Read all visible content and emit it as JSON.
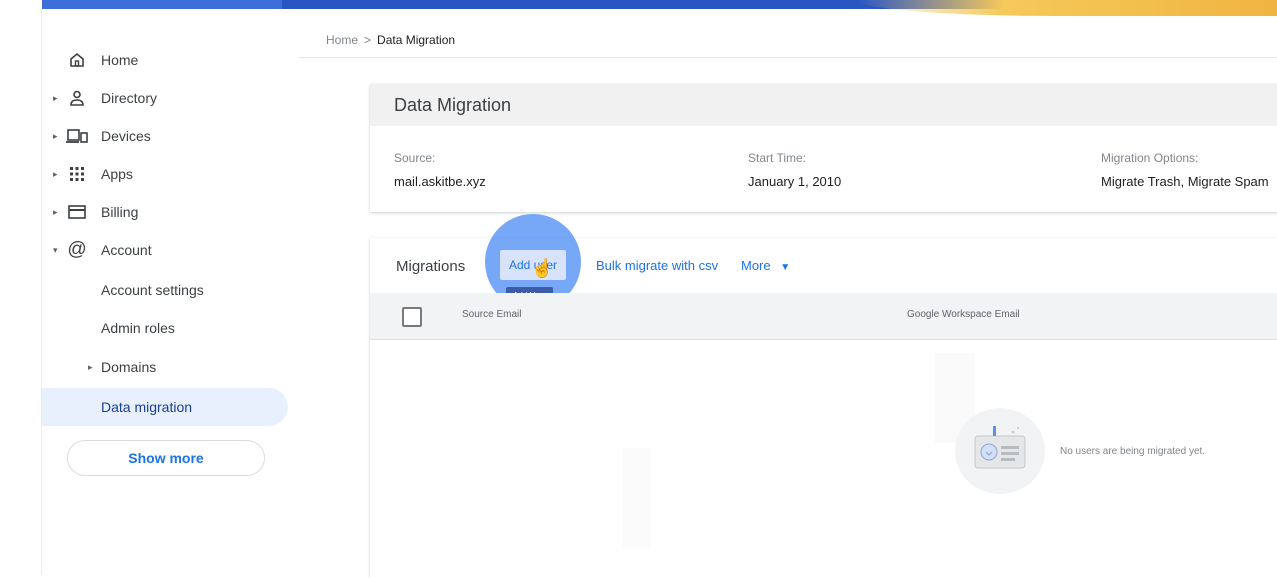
{
  "breadcrumb": {
    "home": "Home",
    "separator": ">",
    "current": "Data Migration"
  },
  "sidebar": {
    "items": [
      {
        "label": "Home",
        "icon": "home-icon",
        "expandable": false
      },
      {
        "label": "Directory",
        "icon": "person-icon",
        "expandable": true
      },
      {
        "label": "Devices",
        "icon": "devices-icon",
        "expandable": true
      },
      {
        "label": "Apps",
        "icon": "apps-grid-icon",
        "expandable": true
      },
      {
        "label": "Billing",
        "icon": "credit-card-icon",
        "expandable": true
      },
      {
        "label": "Account",
        "icon": "at-sign-icon",
        "expandable": true,
        "expanded": true
      }
    ],
    "account_children": [
      {
        "label": "Account settings"
      },
      {
        "label": "Admin roles"
      },
      {
        "label": "Domains",
        "expandable": true
      },
      {
        "label": "Data migration",
        "active": true
      }
    ],
    "show_more": "Show more"
  },
  "summary": {
    "title": "Data Migration",
    "source_label": "Source:",
    "source_value": "mail.askitbe.xyz",
    "start_label": "Start Time:",
    "start_value": "January 1, 2010",
    "options_label": "Migration Options:",
    "options_value": "Migrate Trash, Migrate Spam"
  },
  "migrations": {
    "title": "Migrations",
    "add_user": "Add user",
    "add_user_tooltip": "Add User",
    "bulk": "Bulk migrate with csv",
    "more": "More",
    "columns": [
      "Source Email",
      "Google Workspace Email"
    ],
    "empty_message": "No users are being migrated yet."
  },
  "colors": {
    "accent": "#1a73e8",
    "active_bg": "#e8f0fe",
    "halo": "#4285f4"
  }
}
